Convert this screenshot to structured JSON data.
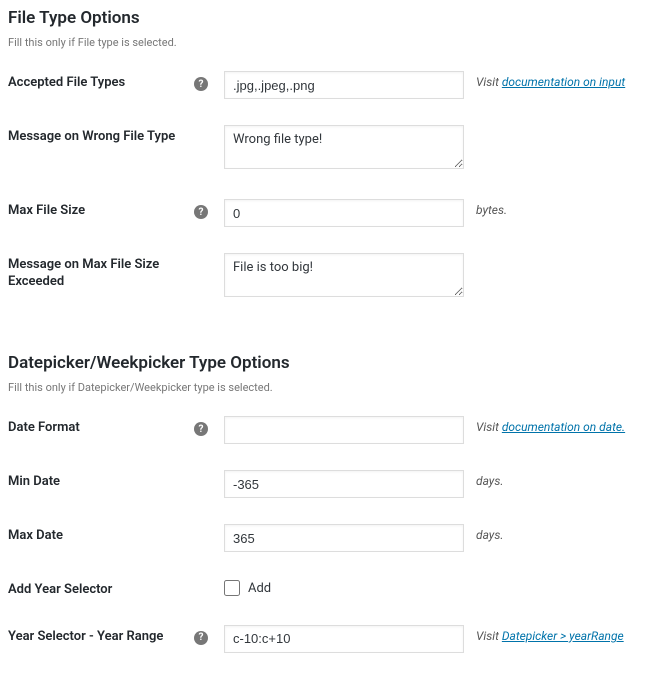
{
  "section1": {
    "title": "File Type Options",
    "subtitle": "Fill this only if File type is selected."
  },
  "accepted_types": {
    "label": "Accepted File Types",
    "value": ".jpg,.jpeg,.png",
    "note_prefix": "Visit ",
    "note_link": "documentation on input"
  },
  "wrong_type_msg": {
    "label": "Message on Wrong File Type",
    "value": "Wrong file type!"
  },
  "max_size": {
    "label": "Max File Size",
    "value": "0",
    "note": "bytes."
  },
  "max_size_msg": {
    "label": "Message on Max File Size Exceeded",
    "value": "File is too big!"
  },
  "section2": {
    "title": "Datepicker/Weekpicker Type Options",
    "subtitle": "Fill this only if Datepicker/Weekpicker type is selected."
  },
  "date_format": {
    "label": "Date Format",
    "value": "",
    "note_prefix": "Visit ",
    "note_link": "documentation on date."
  },
  "min_date": {
    "label": "Min Date",
    "value": "-365",
    "note": "days."
  },
  "max_date": {
    "label": "Max Date",
    "value": "365",
    "note": "days."
  },
  "year_selector": {
    "label": "Add Year Selector",
    "checkbox_label": "Add"
  },
  "year_range": {
    "label": "Year Selector - Year Range",
    "value": "c-10:c+10",
    "note_prefix": "Visit ",
    "note_link": "Datepicker > yearRange"
  }
}
